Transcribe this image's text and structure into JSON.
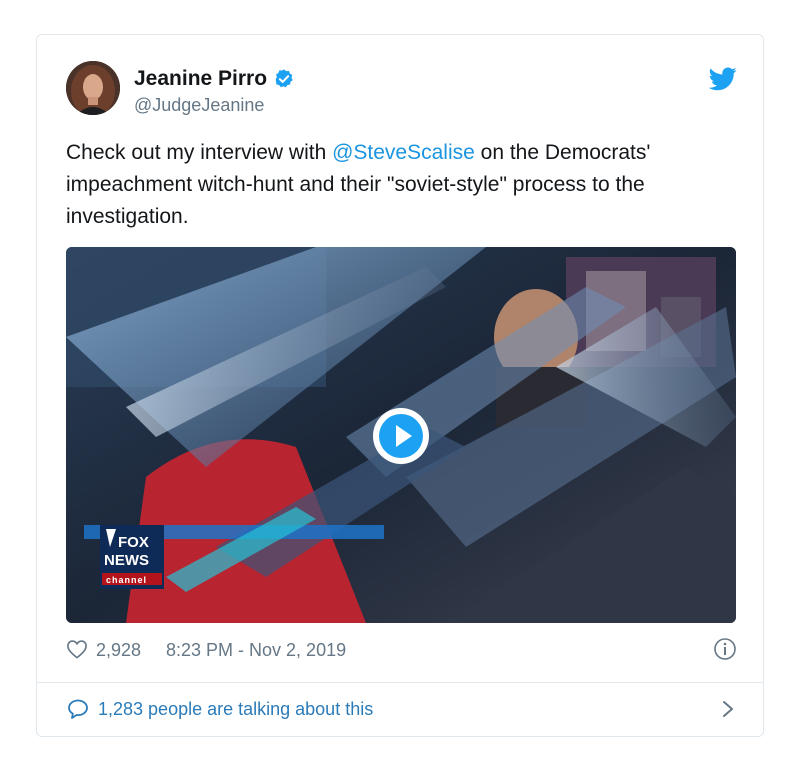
{
  "tweet": {
    "author": {
      "display_name": "Jeanine Pirro",
      "handle": "@JudgeJeanine",
      "verified_icon": "verified-badge-icon",
      "avatar": "avatar"
    },
    "brand_icon": "twitter-bird-icon",
    "text_before": "Check out my interview with ",
    "mention": "@SteveScalise",
    "text_after": " on the Democrats' impeachment witch-hunt and their \"soviet-style\" process to the investigation.",
    "media": {
      "type": "video",
      "logo_line1": "FOX",
      "logo_line2": "NEWS",
      "logo_line3": "channel",
      "play_icon": "play-icon"
    },
    "likes": "2,928",
    "timestamp": "8:23 PM - Nov 2, 2019",
    "info_icon": "info-icon",
    "conversation_label": "1,283 people are talking about this"
  },
  "colors": {
    "accent": "#1da1f2",
    "link": "#1b95e0",
    "muted": "#657786",
    "text": "#14171a",
    "border": "#e1e8ed"
  }
}
